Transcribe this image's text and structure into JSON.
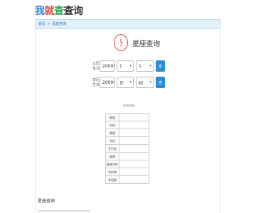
{
  "logo": [
    "我",
    "就",
    "查",
    "查询"
  ],
  "breadcrumb": {
    "home": "首页",
    "sep": ">",
    "current": "星座查询"
  },
  "title": "星座查询",
  "icon_names": {
    "title_icon": "clock-icon",
    "caret": "chevron-down-icon"
  },
  "form": {
    "row1": {
      "label": "公历生日",
      "year": "2000",
      "month": "1",
      "day": "1",
      "button": "查"
    },
    "row2": {
      "label": "农历生日",
      "year": "2000",
      "month": "正",
      "day": "初",
      "button": "查"
    }
  },
  "result_caption": "查询结果",
  "table": [
    {
      "k": "星座",
      "v": ""
    },
    {
      "k": "时间",
      "v": ""
    },
    {
      "k": "属相",
      "v": ""
    },
    {
      "k": "年份",
      "v": ""
    },
    {
      "k": "生日花",
      "v": ""
    },
    {
      "k": "星期",
      "v": ""
    },
    {
      "k": "星座守护",
      "v": ""
    },
    {
      "k": "守护神",
      "v": ""
    },
    {
      "k": "幸运数",
      "v": ""
    }
  ],
  "footer_title": "星座查询",
  "colors": {
    "accent": "#2a8fd8",
    "logo_red": "#e0463c",
    "logo_green": "#2fa84f",
    "crumb_bg": "#e3f1fb"
  }
}
